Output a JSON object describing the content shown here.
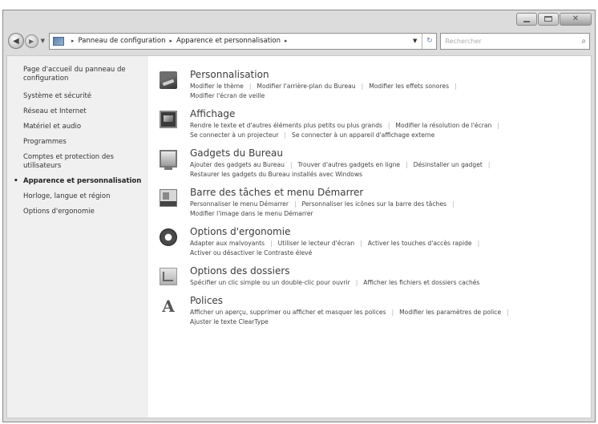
{
  "window": {
    "caption_glyph_close": "✕"
  },
  "nav": {
    "back_glyph": "◀",
    "forward_glyph": "▶",
    "dropdown_glyph": "▼",
    "breadcrumb": [
      "Panneau de configuration",
      "Apparence et personnalisation"
    ],
    "crumb_separator": "▸",
    "address_drop_glyph": "▼",
    "refresh_glyph": "↻",
    "search_placeholder": "Rechercher",
    "search_glyph": "⌕"
  },
  "sidebar": {
    "items": [
      {
        "label": "Page d'accueil du panneau de configuration",
        "current": false
      },
      {
        "label": "Système et sécurité",
        "current": false
      },
      {
        "label": "Réseau et Internet",
        "current": false
      },
      {
        "label": "Matériel et audio",
        "current": false
      },
      {
        "label": "Programmes",
        "current": false
      },
      {
        "label": "Comptes et protection des utilisateurs",
        "current": false
      },
      {
        "label": "Apparence et personnalisation",
        "current": true
      },
      {
        "label": "Horloge, langue et région",
        "current": false
      },
      {
        "label": "Options d'ergonomie",
        "current": false
      }
    ]
  },
  "categories": [
    {
      "icon": "personalization-icon",
      "title": "Personnalisation",
      "links": [
        "Modifier le thème",
        "Modifier l'arrière-plan du Bureau",
        "Modifier les effets sonores",
        "Modifier l'écran de veille"
      ]
    },
    {
      "icon": "display-icon",
      "title": "Affichage",
      "links": [
        "Rendre le texte et d'autres éléments plus petits ou plus grands",
        "Modifier la résolution de l'écran",
        "Se connecter à un projecteur",
        "Se connecter à un appareil d'affichage externe"
      ]
    },
    {
      "icon": "gadgets-icon",
      "title": "Gadgets du Bureau",
      "links": [
        "Ajouter des gadgets au Bureau",
        "Trouver d'autres gadgets en ligne",
        "Désinstaller un gadget",
        "Restaurer les gadgets du Bureau installés avec Windows"
      ]
    },
    {
      "icon": "taskbar-icon",
      "title": "Barre des tâches et menu Démarrer",
      "links": [
        "Personnaliser le menu Démarrer",
        "Personnaliser les icônes sur la barre des tâches",
        "Modifier l'image dans le menu Démarrer"
      ]
    },
    {
      "icon": "ease-of-access-icon",
      "title": "Options d'ergonomie",
      "links": [
        "Adapter aux malvoyants",
        "Utiliser le lecteur d'écran",
        "Activer les touches d'accès rapide",
        "Activer ou désactiver le Contraste élevé"
      ]
    },
    {
      "icon": "folder-options-icon",
      "title": "Options des dossiers",
      "links": [
        "Spécifier un clic simple ou un double-clic pour ouvrir",
        "Afficher les fichiers et dossiers cachés"
      ]
    },
    {
      "icon": "fonts-icon",
      "title": "Polices",
      "glyph": "A",
      "links": [
        "Afficher un aperçu, supprimer ou afficher et masquer les polices",
        "Modifier les paramètres de police",
        "Ajuster le texte ClearType"
      ]
    }
  ]
}
